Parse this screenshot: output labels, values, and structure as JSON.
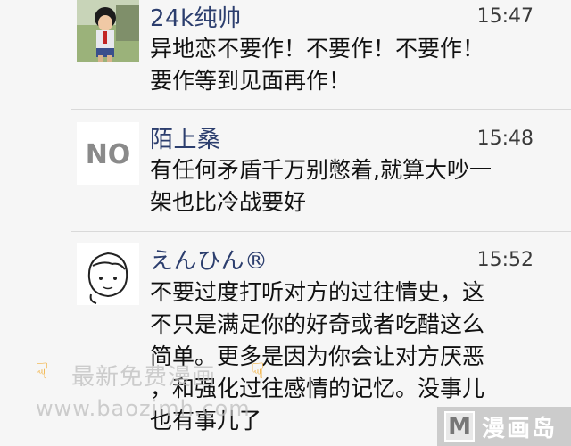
{
  "messages": [
    {
      "name": "24k纯帅",
      "time": "15:47",
      "lines": [
        "异地恋不要作！不要作！不要作！",
        "要作等到见面再作！"
      ]
    },
    {
      "name": "陌上桑",
      "avatar_text": "NO",
      "time": "15:48",
      "lines": [
        "有任何矛盾千万别憋着,就算大吵一",
        "架也比冷战要好"
      ]
    },
    {
      "name": "えんひん®",
      "time": "15:52",
      "lines": [
        "不要过度打听对方的过往情史，这",
        "不只是满足你的好奇或者吃醋这么",
        "简单。更多是因为你会让对方厌恶",
        "，和强化过往感情的记忆。没事儿",
        "也有事儿了"
      ]
    }
  ],
  "watermark": {
    "line1": "最新免费漫画",
    "line2": "www.baozimh.com"
  },
  "brand": {
    "icon_letter": "M",
    "text": "漫画岛"
  }
}
